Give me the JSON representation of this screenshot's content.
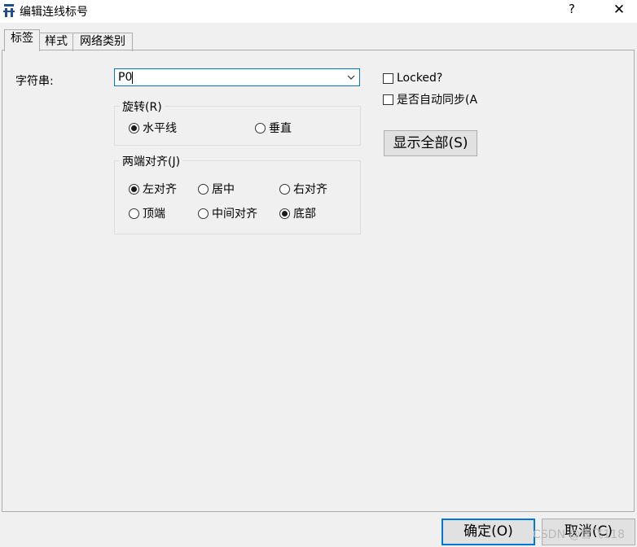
{
  "window": {
    "title": "编辑连线标号",
    "help": "?",
    "close": "✕"
  },
  "tabs": [
    {
      "label": "标签",
      "active": true
    },
    {
      "label": "样式",
      "active": false
    },
    {
      "label": "网络类别",
      "active": false
    }
  ],
  "label_tab": {
    "string_label": "字符串:",
    "string_value": "P0",
    "rotation": {
      "title": "旋转(R)",
      "options": [
        {
          "label": "水平线",
          "selected": true
        },
        {
          "label": "垂直",
          "selected": false
        }
      ]
    },
    "justify": {
      "title": "两端对齐(J)",
      "options": [
        {
          "label": "左对齐",
          "selected": true
        },
        {
          "label": "居中",
          "selected": false
        },
        {
          "label": "右对齐",
          "selected": false
        },
        {
          "label": "顶端",
          "selected": false
        },
        {
          "label": "中间对齐",
          "selected": false
        },
        {
          "label": "底部",
          "selected": true
        }
      ]
    },
    "locked": {
      "label": "Locked?",
      "checked": false
    },
    "auto_sync": {
      "label": "是否自动同步(A",
      "checked": false
    },
    "show_all_button": "显示全部(S)"
  },
  "footer": {
    "ok": "确定(O)",
    "cancel": "取消(C)"
  },
  "watermark": "CSDN @雪飞118"
}
